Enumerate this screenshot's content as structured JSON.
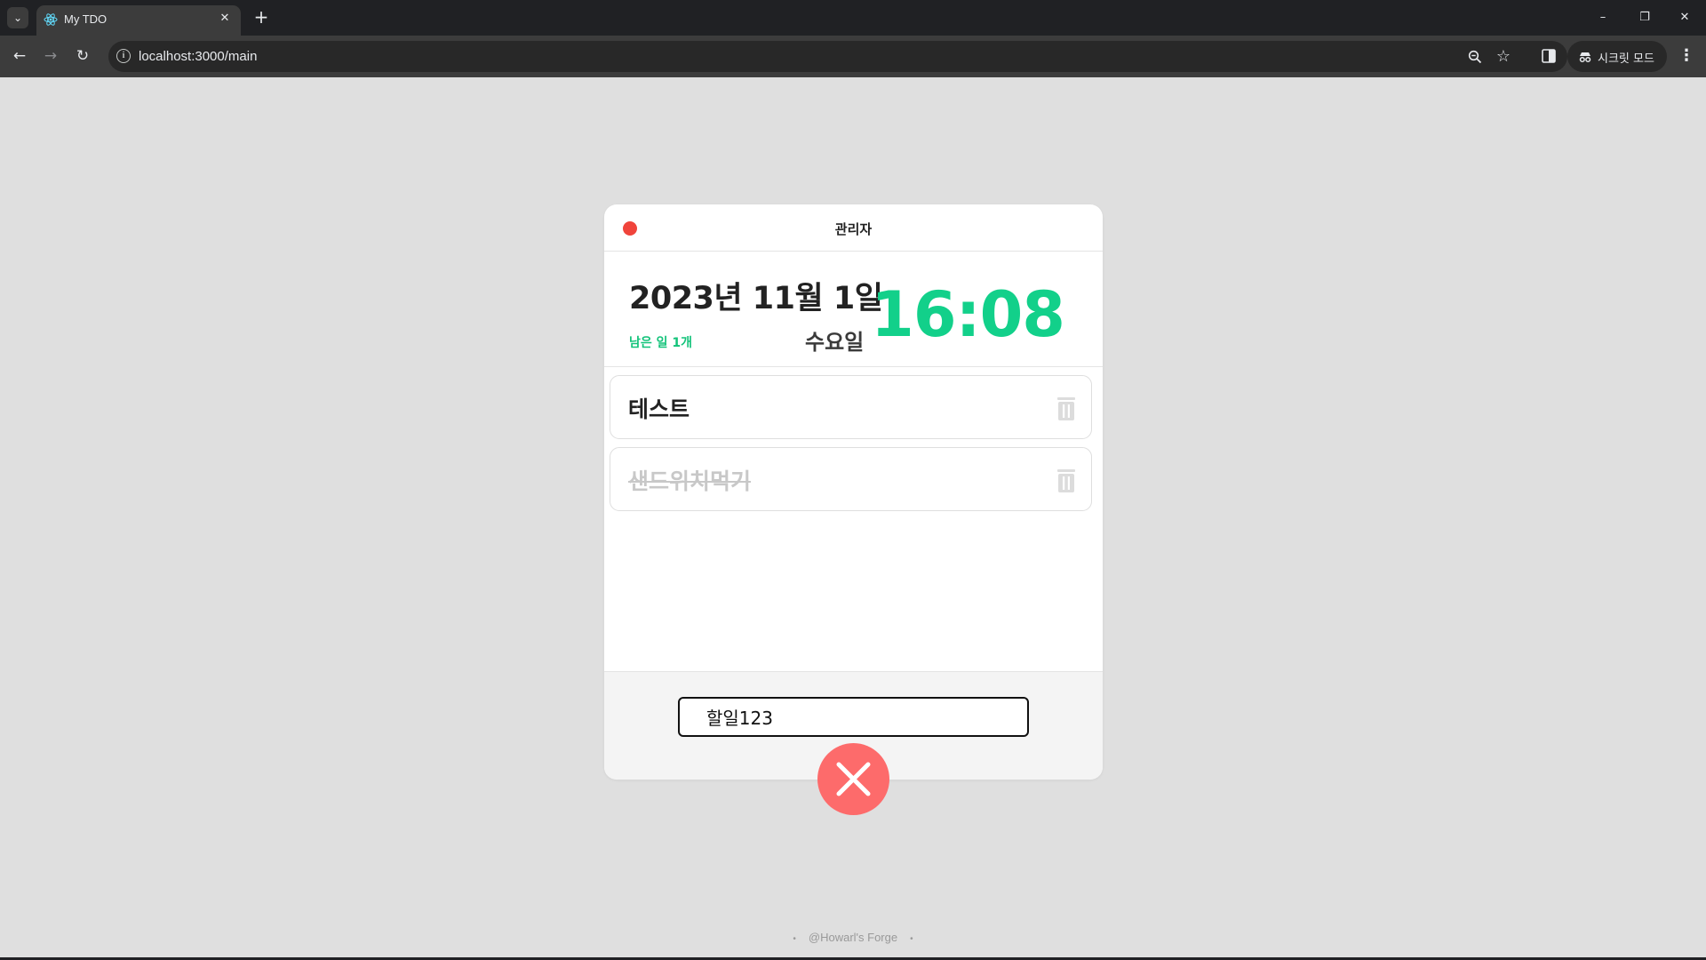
{
  "browser": {
    "tab_title": "My TDO",
    "url": "localhost:3000/main",
    "incognito_label": "시크릿 모드"
  },
  "app": {
    "user_name": "관리자",
    "date": "2023년 11월 1일",
    "weekday": "수요일",
    "remaining": "남은 일 1개",
    "clock": "16:08",
    "accent_color": "#12d08a",
    "danger_color": "#fd6b6b",
    "todos": [
      {
        "text": "테스트",
        "done": false
      },
      {
        "text": "샌드위치먹기",
        "done": true
      }
    ],
    "input_value": "할일123"
  },
  "footer": {
    "credit": "@Howarl's Forge"
  }
}
